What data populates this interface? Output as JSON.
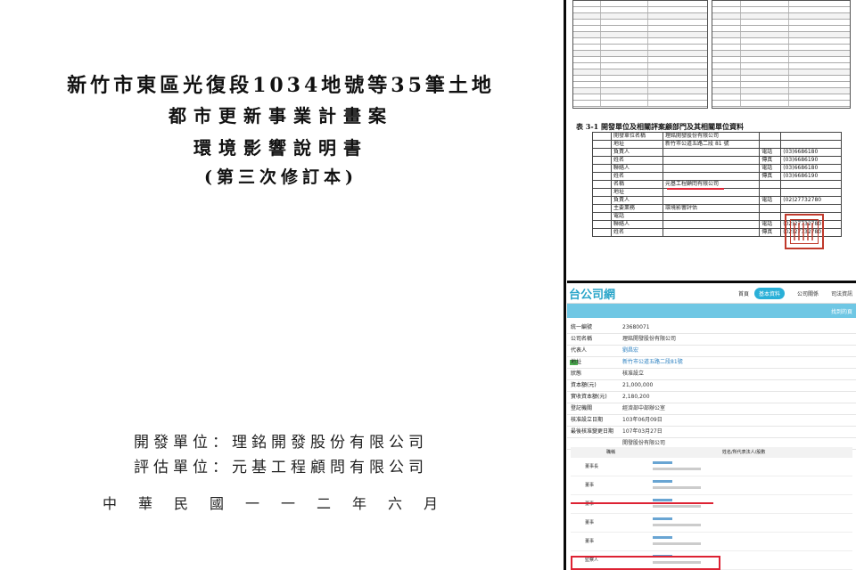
{
  "cover": {
    "title_line1": "新竹市東區光復段1034地號等35筆土地",
    "title_line2": "都市更新事業計畫案",
    "title_line3": "環境影響說明書",
    "title_line4": "(第三次修訂本)",
    "developer_unit": "開發單位：理銘開發股份有限公司",
    "evaluation_unit": "評估單位：元基工程顧問有限公司",
    "date_line": "中華民國一一二年六月"
  },
  "doc_panel": {
    "table_caption": "表 3-1 開發單位及相關評案顧部門及其相關單位資料",
    "table_rows": [
      [
        "",
        "開發單位名稱",
        "理銘開發股份有限公司",
        "",
        ""
      ],
      [
        "",
        "地址",
        "新竹市公道五路二段 81 號",
        "",
        ""
      ],
      [
        "",
        "負責人",
        "",
        "電話",
        "(03)6686180"
      ],
      [
        "",
        "姓名",
        "",
        "傳真",
        "(03)6686190"
      ],
      [
        "",
        "聯絡人",
        "",
        "電話",
        "(03)6686180"
      ],
      [
        "",
        "姓名",
        "",
        "傳真",
        "(03)6686190"
      ],
      [
        "",
        "名稱",
        "元基工程顧問有限公司",
        "",
        ""
      ],
      [
        "",
        "地址",
        "",
        "",
        ""
      ],
      [
        "",
        "負責人",
        "",
        "電話",
        "(02)27732780"
      ],
      [
        "",
        "主要業務",
        "環境影響評估",
        "",
        ""
      ],
      [
        "",
        "電話",
        "",
        "",
        ""
      ],
      [
        "",
        "聯絡人",
        "",
        "電話",
        "(02)27732780"
      ],
      [
        "",
        "姓名",
        "",
        "傳真",
        "(02)27732780"
      ]
    ]
  },
  "web": {
    "logo": "台公司網",
    "nav": {
      "home": "首頁",
      "active": "基本資料",
      "item3": "公司關係",
      "item4": "司法資訊"
    },
    "band_right": "找到的頁",
    "fields": [
      {
        "label": "統一編號",
        "value": "23680071"
      },
      {
        "label": "公司名稱",
        "value": "理銘開發股份有限公司"
      },
      {
        "label": "代表人",
        "value": "劉昌宏"
      },
      {
        "label": "地址",
        "value": "新竹市公道五路二段81號"
      },
      {
        "label": "狀態",
        "value": "核准設立"
      },
      {
        "label": "資本額(元)",
        "value": "21,000,000"
      },
      {
        "label": "實收資本額(元)",
        "value": "2,180,200"
      },
      {
        "label": "登記機關",
        "value": "經濟部中部辦公室"
      },
      {
        "label": "核准設立日期",
        "value": "103年06月09日"
      },
      {
        "label": "最後核准變更日期",
        "value": "107年03月27日"
      },
      {
        "label": "",
        "value": "開發股份有限公司"
      }
    ],
    "directors_header": {
      "role": "職稱",
      "name": "姓名/所代表法人/股數"
    },
    "directors": [
      {
        "role": "董事長"
      },
      {
        "role": "董事"
      },
      {
        "role": "董事"
      },
      {
        "role": "董事"
      },
      {
        "role": "董事"
      },
      {
        "role": "監察人"
      }
    ]
  },
  "colors": {
    "brand": "#2aa5c9",
    "band": "#6fc7e4",
    "highlight": "#dd2233",
    "seal": "#c0392b"
  }
}
